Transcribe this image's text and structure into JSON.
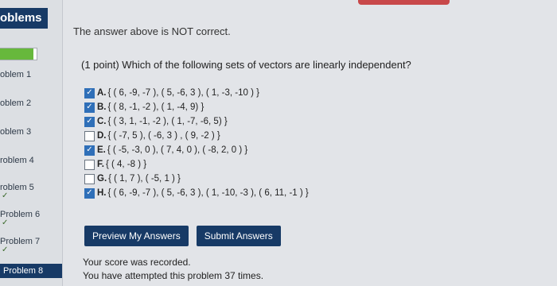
{
  "top_stripe_color": "#c8484a",
  "sidebar": {
    "header": "oblems",
    "progress_fraction": 0.92,
    "items": [
      {
        "label": "oblem 1",
        "checked": false,
        "active": false
      },
      {
        "label": "oblem 2",
        "checked": false,
        "active": false
      },
      {
        "label": "oblem 3",
        "checked": false,
        "active": false
      },
      {
        "label": "roblem 4",
        "checked": false,
        "active": false
      },
      {
        "label": "roblem 5",
        "checked": true,
        "active": false
      },
      {
        "label": "Problem 6",
        "checked": true,
        "active": false
      },
      {
        "label": "Problem 7",
        "checked": true,
        "active": false
      },
      {
        "label": "Problem 8",
        "checked": false,
        "active": true
      }
    ],
    "check_glyph": "✓"
  },
  "main": {
    "status": "The answer above is NOT correct.",
    "question": "(1 point) Which of the following sets of vectors are linearly independent?",
    "options": [
      {
        "letter": "A.",
        "text": "{ ( 6, -9, -7 ), ( 5, -6, 3 ), ( 1, -3, -10 ) }",
        "checked": true
      },
      {
        "letter": "B.",
        "text": "{ ( 8, -1, -2 ), ( 1, -4, 9) }",
        "checked": true
      },
      {
        "letter": "C.",
        "text": "{ ( 3, 1, -1, -2 ), ( 1, -7, -6, 5) }",
        "checked": true
      },
      {
        "letter": "D.",
        "text": "{ ( -7, 5 ), ( -6, 3 ) , ( 9, -2 ) }",
        "checked": false
      },
      {
        "letter": "E.",
        "text": "{ ( -5, -3, 0 ), ( 7, 4, 0 ), ( -8, 2, 0 ) }",
        "checked": true
      },
      {
        "letter": "F.",
        "text": "{ ( 4, -8 ) }",
        "checked": false
      },
      {
        "letter": "G.",
        "text": "{ ( 1, 7 ), ( -5, 1 ) }",
        "checked": false
      },
      {
        "letter": "H.",
        "text": "{ ( 6, -9, -7 ), ( 5, -6, 3 ), ( 1, -10, -3 ), ( 6, 11, -1 ) }",
        "checked": true
      }
    ],
    "buttons": {
      "preview": "Preview My Answers",
      "submit": "Submit Answers"
    },
    "result": {
      "line1": "Your score was recorded.",
      "line2": "You have attempted this problem 37 times."
    }
  }
}
